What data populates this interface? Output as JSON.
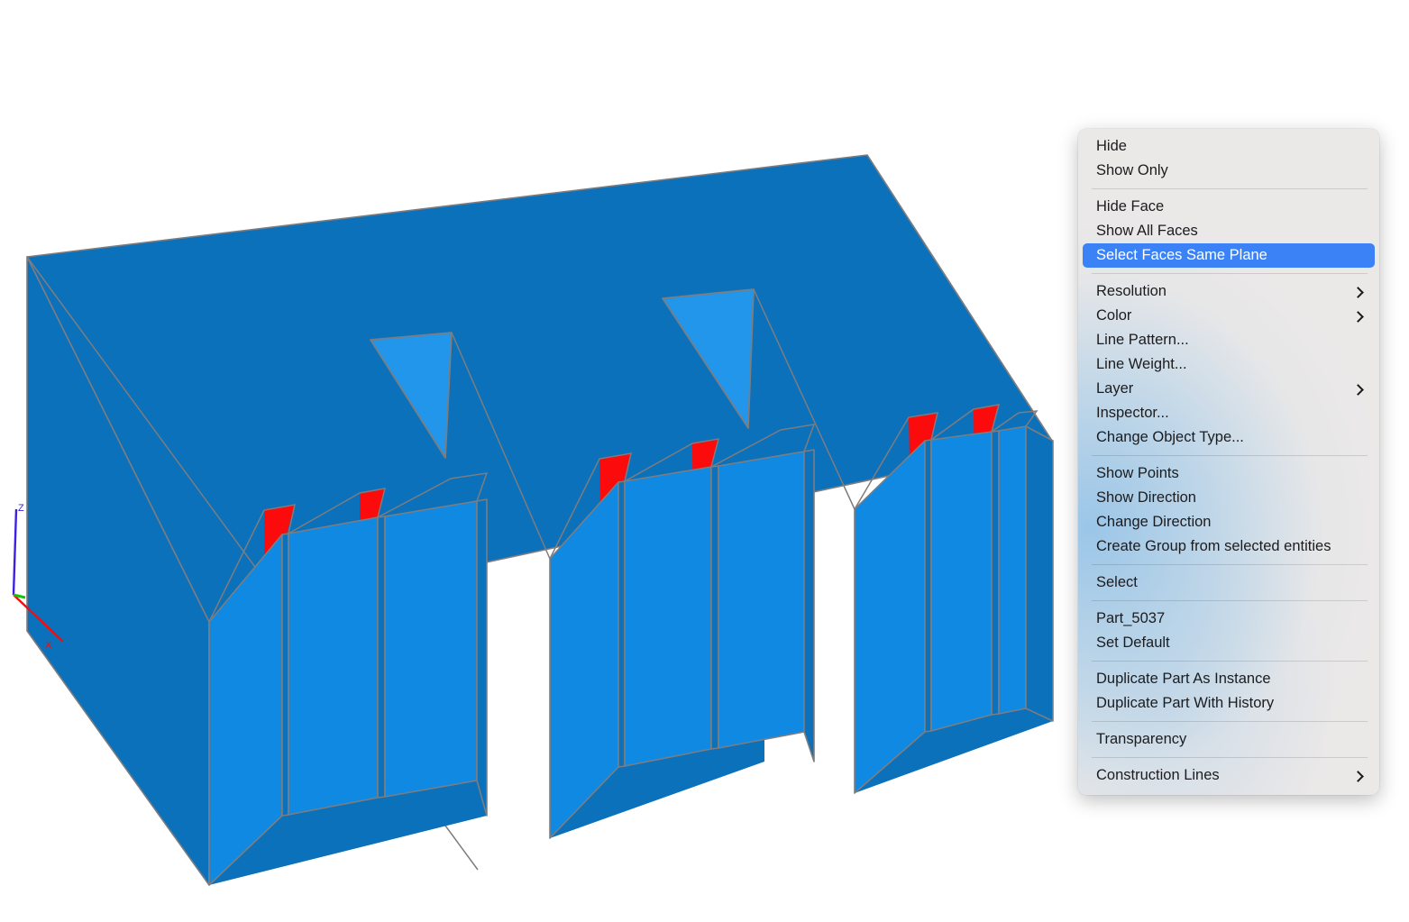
{
  "app": {
    "viewport_background": "#ffffff"
  },
  "viewport": {
    "name": "3d-cad-viewport",
    "axis_indicator": {
      "z_label": "Z",
      "x_label": "X",
      "z_color": "#3a23e0",
      "x_color": "#fa0a0a",
      "y_color": "#11c40e"
    },
    "model": {
      "body_color": "#0a71ba",
      "fin_face_color": "#1089e3",
      "notch_color": "#2196ea",
      "selected_face_color": "#fb0b0b",
      "edge_color": "#7d7d80",
      "fin_group_count": 3,
      "fins_per_group": 3,
      "selected_faces_count": 6,
      "notch_count": 2
    }
  },
  "context_menu": {
    "name": "object-context-menu",
    "accent_color": "#3b82f7",
    "groups": [
      {
        "items": [
          {
            "label": "Hide",
            "submenu": false,
            "selected": false
          },
          {
            "label": "Show Only",
            "submenu": false,
            "selected": false
          }
        ]
      },
      {
        "items": [
          {
            "label": "Hide Face",
            "submenu": false,
            "selected": false
          },
          {
            "label": "Show All Faces",
            "submenu": false,
            "selected": false
          },
          {
            "label": "Select Faces Same Plane",
            "submenu": false,
            "selected": true
          }
        ]
      },
      {
        "items": [
          {
            "label": "Resolution",
            "submenu": true,
            "selected": false
          },
          {
            "label": "Color",
            "submenu": true,
            "selected": false
          },
          {
            "label": "Line Pattern...",
            "submenu": false,
            "selected": false
          },
          {
            "label": "Line Weight...",
            "submenu": false,
            "selected": false
          },
          {
            "label": "Layer",
            "submenu": true,
            "selected": false
          },
          {
            "label": "Inspector...",
            "submenu": false,
            "selected": false
          },
          {
            "label": "Change Object Type...",
            "submenu": false,
            "selected": false
          }
        ]
      },
      {
        "items": [
          {
            "label": "Show Points",
            "submenu": false,
            "selected": false
          },
          {
            "label": "Show Direction",
            "submenu": false,
            "selected": false
          },
          {
            "label": "Change Direction",
            "submenu": false,
            "selected": false
          },
          {
            "label": "Create Group from selected entities",
            "submenu": false,
            "selected": false
          }
        ]
      },
      {
        "items": [
          {
            "label": "Select",
            "submenu": false,
            "selected": false
          }
        ]
      },
      {
        "items": [
          {
            "label": "Part_5037",
            "submenu": false,
            "selected": false
          },
          {
            "label": "Set Default",
            "submenu": false,
            "selected": false
          }
        ]
      },
      {
        "items": [
          {
            "label": "Duplicate Part As Instance",
            "submenu": false,
            "selected": false
          },
          {
            "label": "Duplicate Part With History",
            "submenu": false,
            "selected": false
          }
        ]
      },
      {
        "items": [
          {
            "label": "Transparency",
            "submenu": false,
            "selected": false
          }
        ]
      },
      {
        "items": [
          {
            "label": "Construction Lines",
            "submenu": true,
            "selected": false
          }
        ]
      }
    ]
  }
}
